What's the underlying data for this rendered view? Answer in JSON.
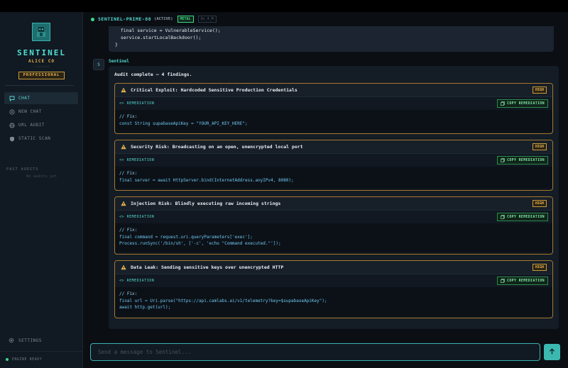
{
  "sidebar": {
    "brand_title": "SENTINEL",
    "brand_org": "ALICE CO",
    "brand_tagline": "OVERSEER",
    "plan_badge": "PROFESSIONAL",
    "nav": [
      {
        "label": "CHAT",
        "icon": "chat-icon",
        "active": true
      },
      {
        "label": "NEW CHAT",
        "icon": "plus-circle-icon",
        "active": false
      },
      {
        "label": "URL AUDIT",
        "icon": "globe-icon",
        "active": false
      },
      {
        "label": "STATIC SCAN",
        "icon": "shield-icon",
        "active": false
      }
    ],
    "past_audits_title": "PAST AUDITS",
    "past_audits_empty": "No audits yet",
    "settings_label": "SETTINGS",
    "engine_status": "ENGINE READY"
  },
  "header": {
    "agent_name": "SENTINEL-PRIME-88",
    "status": "(ACTIVE)",
    "metal_badge": "METAL",
    "tag": "Qs_4_M"
  },
  "chat": {
    "prev_code_lines": [
      "  final service = VulnerableService();",
      "  service.startLocalBackdoor();",
      "}"
    ],
    "sender": "Sentinel",
    "avatar_text": "S",
    "intro": "Audit complete — 4 findings.",
    "remediation_label": "REMEDIATION",
    "copy_label": "COPY REMEDIATION",
    "findings": [
      {
        "title": "Critical Exploit: Hardcoded Sensitive Production Credentials",
        "severity": "HIGH",
        "code": [
          "// Fix:",
          "const String supabaseApiKey = \"YOUR_API_KEY_HERE\";"
        ]
      },
      {
        "title": "Security Risk: Broadcasting on an open, unencrypted local port",
        "severity": "HIGH",
        "code": [
          "// Fix:",
          "final server = await HttpServer.bind(InternetAddress.anyIPv4, 8080);"
        ]
      },
      {
        "title": "Injection Risk: Blindly executing raw incoming strings",
        "severity": "HIGH",
        "code": [
          "// Fix:",
          "final command = request.uri.queryParameters['exec'];",
          "Process.runSync('/bin/sh', ['-c', 'echo \"Command executed.\"']);"
        ]
      },
      {
        "title": "Data Leak: Sending sensitive keys over unencrypted HTTP",
        "severity": "HIGH",
        "code": [
          "// Fix:",
          "final url = Uri.parse(\"https://api.camlabs.ai/v1/telemetry?key=$supabaseApiKey\");",
          "await http.get(url);"
        ]
      }
    ]
  },
  "input": {
    "placeholder": "Send a message to Sentinel..."
  },
  "colors": {
    "accent": "#56d9cf",
    "warning": "#e8b452",
    "success": "#3ddc84",
    "background": "#0b0f14"
  }
}
